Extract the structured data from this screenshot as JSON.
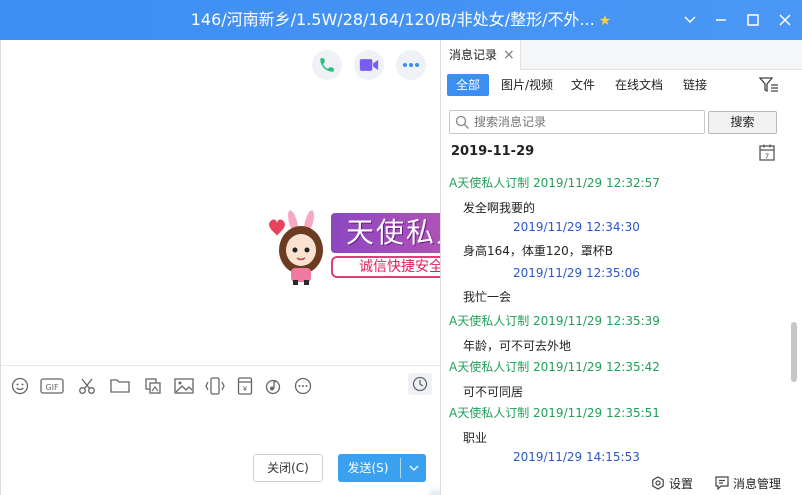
{
  "window": {
    "title": "146/河南新乡/1.5W/28/164/120/B/非处女/整形/不外...",
    "star_icon": "star-icon",
    "controls": [
      "chevron-down-icon",
      "minimize-icon",
      "maximize-icon",
      "close-icon"
    ]
  },
  "chat": {
    "top_actions": [
      "phone-icon",
      "video-icon",
      "more-icon"
    ],
    "promo": {
      "brand": "天使私人订制",
      "slogan": "诚信快捷安全的交友平台"
    },
    "toolbar_icons": [
      "emoji-icon",
      "gif-icon",
      "scissors-icon",
      "folder-icon",
      "image-gallery-icon",
      "image-icon",
      "shake-icon",
      "red-packet-icon",
      "music-icon",
      "more-icon"
    ],
    "history_icon": "clock-icon",
    "close_button": "关闭(C)",
    "send_button": "发送(S)"
  },
  "side": {
    "tab_label": "消息记录",
    "filters": [
      "全部",
      "图片/视频",
      "文件",
      "在线文档",
      "链接"
    ],
    "active_filter": "全部",
    "search_placeholder": "搜索消息记录",
    "search_button": "搜索",
    "date": "2019-11-29",
    "messages": [
      {
        "sender": "A天使私人订制 2019/11/29 12:32:57",
        "text": "发全啊我要的",
        "color": "#21a05a"
      },
      {
        "sender": "2019/11/29 12:34:30",
        "text": "身高164，体重120，罩杯B",
        "color": "#2a57c8"
      },
      {
        "sender": "2019/11/29 12:35:06",
        "text": "我忙一会",
        "color": "#2a57c8"
      },
      {
        "sender": "A天使私人订制 2019/11/29 12:35:39",
        "text": "年龄，可不可去外地",
        "color": "#21a05a"
      },
      {
        "sender": "A天使私人订制 2019/11/29 12:35:42",
        "text": "可不可同居",
        "color": "#21a05a"
      },
      {
        "sender": "A天使私人订制 2019/11/29 12:35:51",
        "text": "职业",
        "color": "#21a05a"
      },
      {
        "sender": "2019/11/29 14:15:53",
        "text": "",
        "color": "#2a57c8"
      }
    ],
    "footer": {
      "settings": "设置",
      "manage": "消息管理"
    }
  }
}
